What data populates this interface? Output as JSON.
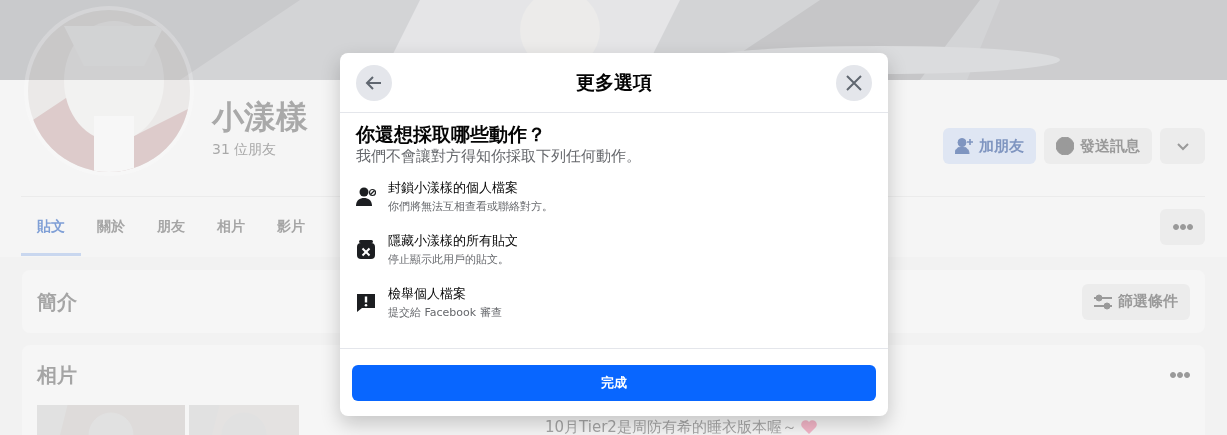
{
  "profile": {
    "name": "小漾樣",
    "friends": "31 位朋友"
  },
  "profile_buttons": [
    {
      "kind": "add-friend",
      "label": "加朋友"
    },
    {
      "kind": "message",
      "label": "發送訊息"
    },
    {
      "kind": "dropdown"
    }
  ],
  "tabs": [
    {
      "label": "貼文",
      "selected": true
    },
    {
      "label": "關於",
      "selected": false
    },
    {
      "label": "朋友",
      "selected": false
    },
    {
      "label": "相片",
      "selected": false
    },
    {
      "label": "影片",
      "selected": false
    }
  ],
  "intro": {
    "title": "簡介",
    "filter_button": "篩選條件"
  },
  "photos": {
    "title": "相片"
  },
  "post_text": "10月Tier2是周防有希的睡衣版本喔～",
  "dialog": {
    "title": "更多選項",
    "heading": "你還想採取哪些動作？",
    "subtitle": "我們不會讓對方得知你採取下列任何動作。",
    "options": [
      {
        "kind": "block",
        "title": "封鎖小漾樣的個人檔案",
        "description": "你們將無法互相查看或聯絡對方。"
      },
      {
        "kind": "hide",
        "title": "隱藏小漾樣的所有貼文",
        "description": "停止顯示此用戶的貼文。"
      },
      {
        "kind": "report",
        "title": "檢舉個人檔案",
        "description": "提交給 Facebook 審查"
      }
    ],
    "done_button": "完成"
  }
}
